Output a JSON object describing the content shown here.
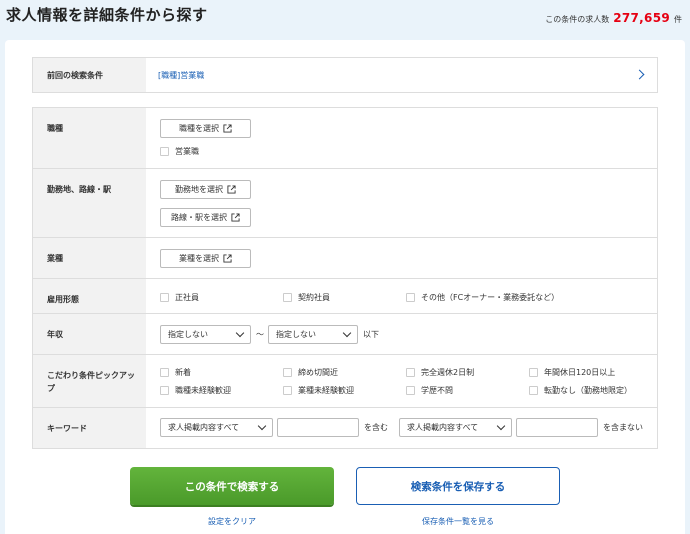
{
  "header": {
    "title": "求人情報を詳細条件から探す",
    "count_prefix": "この条件の求人数",
    "count_value": "277,659",
    "count_suffix": "件"
  },
  "previous": {
    "label": "前回の検索条件",
    "value": "[職種]営業職"
  },
  "rows": {
    "job_type": {
      "label": "職種",
      "button": "職種を選択",
      "checkbox": "営業職"
    },
    "location": {
      "label": "勤務地、路線・駅",
      "button_area": "勤務地を選択",
      "button_line": "路線・駅を選択"
    },
    "industry": {
      "label": "業種",
      "button": "業種を選択"
    },
    "employment": {
      "label": "雇用形態",
      "options": [
        "正社員",
        "契約社員",
        "その他（FCオーナー・業務委託など）"
      ]
    },
    "salary": {
      "label": "年収",
      "min": "指定しない",
      "tilde": "〜",
      "max": "指定しない",
      "suffix": "以下"
    },
    "pickup": {
      "label": "こだわり条件ピックアップ",
      "options": [
        "新着",
        "締め切間近",
        "完全週休2日制",
        "年間休日120日以上",
        "職種未経験歓迎",
        "業種未経験歓迎",
        "学歴不問",
        "転勤なし（勤務地限定）"
      ]
    },
    "keyword": {
      "label": "キーワード",
      "include_scope": "求人掲載内容すべて",
      "include_suffix": "を含む",
      "exclude_scope": "求人掲載内容すべて",
      "exclude_suffix": "を含まない"
    }
  },
  "actions": {
    "search": "この条件で検索する",
    "save": "検索条件を保存する",
    "clear": "設定をクリア",
    "saved_list": "保存条件一覧を見る"
  },
  "colors": {
    "accent_blue": "#1a5fb4",
    "count_red": "#e60012",
    "primary_green": "#58a932"
  }
}
